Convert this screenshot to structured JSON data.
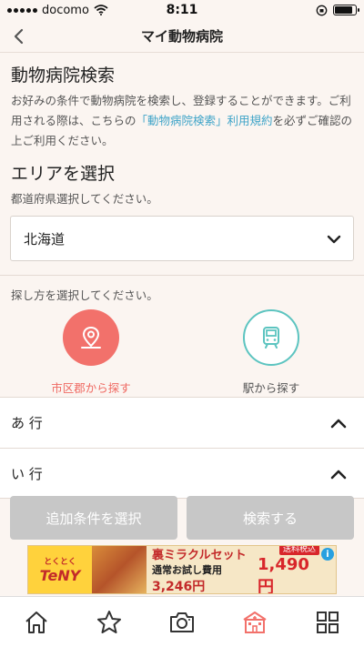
{
  "status_bar": {
    "carrier": "docomo",
    "time": "8:11",
    "battery_level": 0.85
  },
  "nav": {
    "title": "マイ動物病院",
    "back_icon": "chevron-left-icon"
  },
  "search": {
    "title": "動物病院検索",
    "description_part1": "お好みの条件で動物病院を検索し、登録することができます。ご利用される際は、こちらの",
    "terms_link": "「動物病院検索」利用規約",
    "description_part2": "を必ずご確認の上ご利用ください。"
  },
  "area": {
    "title": "エリアを選択",
    "instruction": "都道府県選択してください。",
    "selected_prefecture": "北海道"
  },
  "method": {
    "instruction": "探し方を選択してください。",
    "options": [
      {
        "label": "市区郡から探す",
        "icon": "map-pin-icon",
        "active": true
      },
      {
        "label": "駅から探す",
        "icon": "train-icon",
        "active": false
      }
    ]
  },
  "rows": [
    {
      "label": "あ 行"
    },
    {
      "label": "い 行"
    }
  ],
  "buttons": {
    "additional_conditions": "追加条件を選択",
    "search": "検索する"
  },
  "ad": {
    "brand_small": "とくとく",
    "brand": "TeNY",
    "headline": "裏ミラクルセット",
    "sub_text": "通常お試し費用",
    "sub_price": "3,246円",
    "tag": "送料税込",
    "price": "1,490円",
    "info_icon": "info-icon"
  },
  "tab_bar": {
    "items": [
      {
        "name": "home",
        "icon": "home-icon"
      },
      {
        "name": "favorites",
        "icon": "star-icon"
      },
      {
        "name": "camera",
        "icon": "camera-icon"
      },
      {
        "name": "hospital",
        "icon": "hospital-icon",
        "active": true
      },
      {
        "name": "menu",
        "icon": "grid-icon"
      }
    ]
  },
  "colors": {
    "background": "#fbf5f1",
    "accent_red": "#f2716b",
    "accent_teal": "#5cc4c0",
    "link": "#3fa4c8",
    "disabled_button": "#c7c7c7"
  }
}
